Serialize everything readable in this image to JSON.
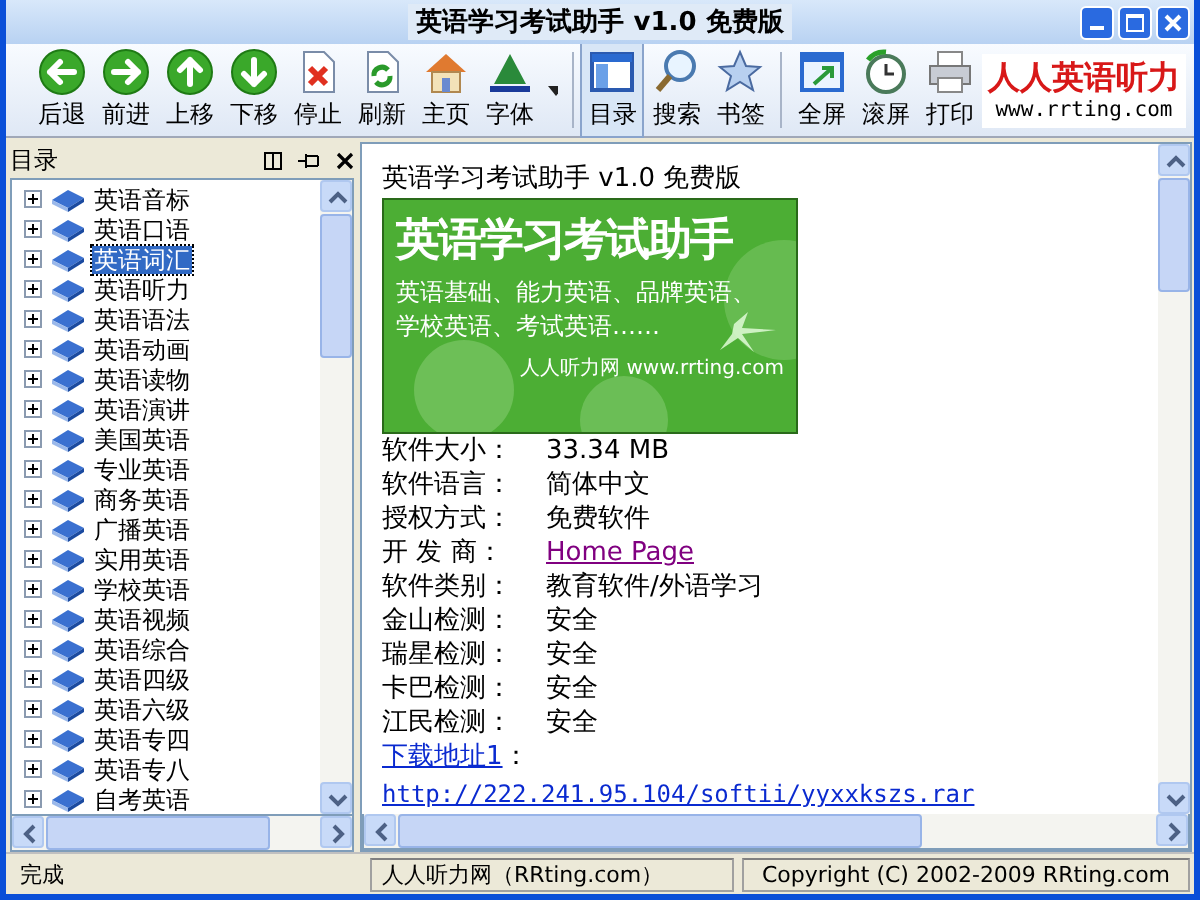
{
  "window": {
    "title": "英语学习考试助手 v1.0 免费版"
  },
  "toolbar": [
    {
      "buttons": [
        {
          "label": "后退",
          "selected": false
        },
        {
          "label": "前进",
          "selected": false
        },
        {
          "label": "上移",
          "selected": false
        },
        {
          "label": "下移",
          "selected": false
        },
        {
          "label": "停止",
          "selected": false
        },
        {
          "label": "刷新",
          "selected": false
        },
        {
          "label": "主页",
          "selected": false
        },
        {
          "label": "字体",
          "selected": false
        }
      ]
    },
    {
      "buttons": [
        {
          "label": "目录",
          "selected": true
        },
        {
          "label": "搜索",
          "selected": false
        },
        {
          "label": "书签",
          "selected": false
        }
      ]
    },
    {
      "buttons": [
        {
          "label": "全屏",
          "selected": false
        },
        {
          "label": "滚屏",
          "selected": false
        },
        {
          "label": "打印",
          "selected": false
        }
      ]
    }
  ],
  "logo": {
    "title": "人人英语听力",
    "url": "www.rrting.com"
  },
  "sidebar": {
    "title": "目录",
    "items": [
      {
        "label": "英语音标",
        "selected": false,
        "expanded": false
      },
      {
        "label": "英语口语",
        "selected": false,
        "expanded": false
      },
      {
        "label": "英语词汇",
        "selected": true,
        "expanded": false
      },
      {
        "label": "英语听力",
        "selected": false,
        "expanded": false
      },
      {
        "label": "英语语法",
        "selected": false,
        "expanded": false
      },
      {
        "label": "英语动画",
        "selected": false,
        "expanded": false
      },
      {
        "label": "英语读物",
        "selected": false,
        "expanded": false
      },
      {
        "label": "英语演讲",
        "selected": false,
        "expanded": false
      },
      {
        "label": "美国英语",
        "selected": false,
        "expanded": false
      },
      {
        "label": "专业英语",
        "selected": false,
        "expanded": false
      },
      {
        "label": "商务英语",
        "selected": false,
        "expanded": false
      },
      {
        "label": "广播英语",
        "selected": false,
        "expanded": false
      },
      {
        "label": "实用英语",
        "selected": false,
        "expanded": false
      },
      {
        "label": "学校英语",
        "selected": false,
        "expanded": false
      },
      {
        "label": "英语视频",
        "selected": false,
        "expanded": false
      },
      {
        "label": "英语综合",
        "selected": false,
        "expanded": false
      },
      {
        "label": "英语四级",
        "selected": false,
        "expanded": false
      },
      {
        "label": "英语六级",
        "selected": false,
        "expanded": false
      },
      {
        "label": "英语专四",
        "selected": false,
        "expanded": false
      },
      {
        "label": "英语专八",
        "selected": false,
        "expanded": false
      },
      {
        "label": "自考英语",
        "selected": false,
        "expanded": false
      }
    ]
  },
  "content": {
    "heading": "英语学习考试助手 v1.0 免费版",
    "banner": {
      "title": "英语学习考试助手",
      "subtitle_lines": [
        "英语基础、能力英语、品牌英语、",
        "学校英语、考试英语……"
      ],
      "footer": "人人听力网 www.rrting.com"
    },
    "info": [
      {
        "label": "软件大小：",
        "value": "33.34 MB",
        "kind": "text"
      },
      {
        "label": "软件语言：",
        "value": "简体中文",
        "kind": "text"
      },
      {
        "label": "授权方式：",
        "value": "免费软件",
        "kind": "text"
      },
      {
        "label": "开 发 商：",
        "value": "Home Page",
        "kind": "link"
      },
      {
        "label": "软件类别：",
        "value": "教育软件/外语学习",
        "kind": "text"
      },
      {
        "label": "金山检测：",
        "value": "安全",
        "kind": "text"
      },
      {
        "label": "瑞星检测：",
        "value": "安全",
        "kind": "text"
      },
      {
        "label": "卡巴检测：",
        "value": "安全",
        "kind": "text"
      },
      {
        "label": "江民检测：",
        "value": "安全",
        "kind": "text"
      }
    ],
    "download": {
      "label": "下载地址1",
      "separator": "：",
      "url": "http://222.241.95.104/softii/yyxxkszs.rar"
    }
  },
  "status_bar": [
    "完成",
    "人人听力网（RRting.com）",
    "Copyright (C) 2002-2009 RRting.com"
  ]
}
